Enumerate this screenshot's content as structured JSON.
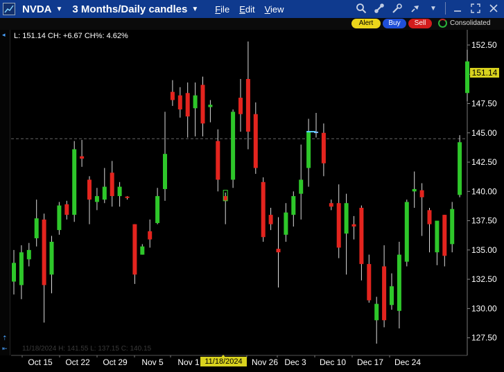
{
  "window": {
    "symbol": "NVDA",
    "period": "3 Months/Daily candles",
    "menu": [
      {
        "pre": "",
        "u": "F",
        "post": "ile"
      },
      {
        "pre": "",
        "u": "E",
        "post": "dit"
      },
      {
        "pre": "",
        "u": "V",
        "post": "iew"
      }
    ]
  },
  "toolbar": {
    "alert_label": "Alert",
    "buy_label": "Buy",
    "sell_label": "Sell",
    "feed_label": "Consolidated"
  },
  "chart_header": {
    "ohlc_text": "L: 151.14 CH: +6.67 CH%: 4.62%",
    "last_price_flag": "151.14",
    "hover_info": "11/18/2024   H: 141.55  L: 137.15  C: 140.15",
    "date_cursor": "11/18/2024"
  },
  "chart_data": {
    "type": "candlestick",
    "y_range": [
      126,
      153.8
    ],
    "y_ticks": [
      "127.50",
      "130.00",
      "132.50",
      "135.00",
      "137.50",
      "140.00",
      "142.50",
      "145.00",
      "147.50",
      "150.00",
      "152.50"
    ],
    "x_labels": [
      "Oct 15",
      "Oct 22",
      "Oct 29",
      "Nov 5",
      "Nov 1",
      "Nov 26",
      "Dec 3",
      "Dec 10",
      "Dec 17",
      "Dec 24"
    ],
    "reference_level": 144.5,
    "colors": {
      "up": "#2ec72a",
      "down": "#e3241e",
      "flat": "#7cb8ff"
    },
    "candles": [
      {
        "o": 132.3,
        "h": 135.0,
        "l": 131.2,
        "c": 133.9
      },
      {
        "o": 132.0,
        "h": 135.4,
        "l": 130.8,
        "c": 134.8
      },
      {
        "o": 134.2,
        "h": 135.6,
        "l": 133.6,
        "c": 135.0
      },
      {
        "o": 136.0,
        "h": 139.3,
        "l": 135.3,
        "c": 137.7
      },
      {
        "o": 137.6,
        "h": 138.1,
        "l": 128.8,
        "c": 132.0
      },
      {
        "o": 132.9,
        "h": 136.2,
        "l": 131.3,
        "c": 135.7
      },
      {
        "o": 136.7,
        "h": 139.1,
        "l": 136.3,
        "c": 138.8
      },
      {
        "o": 138.9,
        "h": 139.2,
        "l": 137.6,
        "c": 138.0
      },
      {
        "o": 138.0,
        "h": 144.3,
        "l": 137.4,
        "c": 143.6
      },
      {
        "o": 143.0,
        "h": 144.4,
        "l": 142.1,
        "c": 142.8
      },
      {
        "o": 141.0,
        "h": 141.3,
        "l": 137.2,
        "c": 139.3
      },
      {
        "o": 139.1,
        "h": 140.3,
        "l": 138.4,
        "c": 139.6
      },
      {
        "o": 139.3,
        "h": 142.0,
        "l": 139.0,
        "c": 140.4
      },
      {
        "o": 141.6,
        "h": 142.6,
        "l": 138.7,
        "c": 139.6
      },
      {
        "o": 139.6,
        "h": 140.8,
        "l": 138.7,
        "c": 140.4
      },
      {
        "o": 139.5,
        "h": 139.6,
        "l": 139.3,
        "c": 139.5
      },
      {
        "o": 137.2,
        "h": 137.2,
        "l": 132.1,
        "c": 132.9
      },
      {
        "o": 134.6,
        "h": 135.5,
        "l": 134.6,
        "c": 135.3
      },
      {
        "o": 136.6,
        "h": 137.6,
        "l": 135.2,
        "c": 135.9
      },
      {
        "o": 137.3,
        "h": 140.3,
        "l": 137.2,
        "c": 139.6
      },
      {
        "o": 140.2,
        "h": 146.8,
        "l": 139.2,
        "c": 143.2
      },
      {
        "o": 148.5,
        "h": 149.5,
        "l": 147.3,
        "c": 147.8
      },
      {
        "o": 148.2,
        "h": 148.9,
        "l": 146.3,
        "c": 147.0
      },
      {
        "o": 148.4,
        "h": 149.3,
        "l": 144.6,
        "c": 146.4
      },
      {
        "o": 147.1,
        "h": 149.3,
        "l": 144.7,
        "c": 148.2
      },
      {
        "o": 149.1,
        "h": 149.8,
        "l": 144.7,
        "c": 145.8
      },
      {
        "o": 147.2,
        "h": 147.8,
        "l": 145.9,
        "c": 147.4
      },
      {
        "o": 144.3,
        "h": 145.3,
        "l": 140.0,
        "c": 141.0
      },
      {
        "o": 139.6,
        "h": 139.9,
        "l": 137.2,
        "c": 139.2
      },
      {
        "o": 141.0,
        "h": 147.0,
        "l": 140.3,
        "c": 146.8
      },
      {
        "o": 148.0,
        "h": 149.6,
        "l": 145.1,
        "c": 146.6
      },
      {
        "o": 149.6,
        "h": 152.8,
        "l": 143.6,
        "c": 145.1
      },
      {
        "o": 146.6,
        "h": 147.6,
        "l": 141.5,
        "c": 142.0
      },
      {
        "o": 140.8,
        "h": 141.2,
        "l": 135.7,
        "c": 136.1
      },
      {
        "o": 138.0,
        "h": 138.6,
        "l": 136.7,
        "c": 137.2
      },
      {
        "o": 135.1,
        "h": 137.8,
        "l": 131.8,
        "c": 134.8
      },
      {
        "o": 136.3,
        "h": 139.0,
        "l": 135.7,
        "c": 138.2
      },
      {
        "o": 138.0,
        "h": 140.0,
        "l": 137.0,
        "c": 139.6
      },
      {
        "o": 139.8,
        "h": 144.0,
        "l": 137.6,
        "c": 141.0
      },
      {
        "o": 142.0,
        "h": 146.2,
        "l": 140.4,
        "c": 145.1
      },
      {
        "o": 145.1,
        "h": 146.7,
        "l": 144.6,
        "c": 145.1
      },
      {
        "o": 145.0,
        "h": 145.8,
        "l": 141.3,
        "c": 142.4
      },
      {
        "o": 139.0,
        "h": 139.3,
        "l": 138.4,
        "c": 138.7
      },
      {
        "o": 139.0,
        "h": 140.6,
        "l": 134.3,
        "c": 135.2
      },
      {
        "o": 136.4,
        "h": 139.8,
        "l": 132.9,
        "c": 139.0
      },
      {
        "o": 137.2,
        "h": 137.9,
        "l": 135.9,
        "c": 137.0
      },
      {
        "o": 138.6,
        "h": 138.8,
        "l": 132.4,
        "c": 133.8
      },
      {
        "o": 133.8,
        "h": 134.6,
        "l": 130.5,
        "c": 130.7
      },
      {
        "o": 129.0,
        "h": 131.0,
        "l": 127.0,
        "c": 130.4
      },
      {
        "o": 133.6,
        "h": 135.4,
        "l": 128.4,
        "c": 129.0
      },
      {
        "o": 130.3,
        "h": 133.0,
        "l": 129.9,
        "c": 131.9
      },
      {
        "o": 129.8,
        "h": 135.7,
        "l": 128.3,
        "c": 134.6
      },
      {
        "o": 134.0,
        "h": 139.3,
        "l": 133.6,
        "c": 139.1
      },
      {
        "o": 140.0,
        "h": 141.7,
        "l": 138.6,
        "c": 140.2
      },
      {
        "o": 140.1,
        "h": 140.7,
        "l": 136.2,
        "c": 139.5
      },
      {
        "o": 138.4,
        "h": 138.6,
        "l": 134.8,
        "c": 137.2
      },
      {
        "o": 134.8,
        "h": 137.3,
        "l": 133.7,
        "c": 137.5
      },
      {
        "o": 138.0,
        "h": 138.0,
        "l": 133.6,
        "c": 134.5
      },
      {
        "o": 135.5,
        "h": 139.1,
        "l": 134.8,
        "c": 138.5
      },
      {
        "o": 139.7,
        "h": 144.8,
        "l": 139.5,
        "c": 144.2
      },
      {
        "o": 148.4,
        "h": 152.1,
        "l": 147.7,
        "c": 151.1
      }
    ]
  }
}
